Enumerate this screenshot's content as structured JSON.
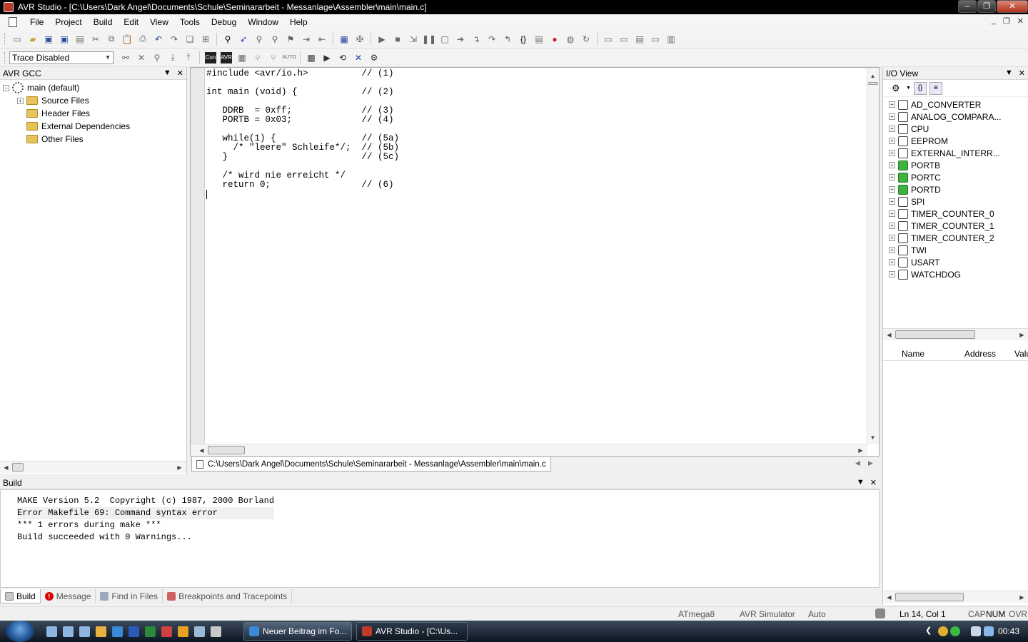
{
  "window": {
    "title": "AVR Studio - [C:\\Users\\Dark Angel\\Documents\\Schule\\Seminararbeit - Messanlage\\Assembler\\main\\main.c]"
  },
  "menu": [
    "File",
    "Project",
    "Build",
    "Edit",
    "View",
    "Tools",
    "Debug",
    "Window",
    "Help"
  ],
  "toolbar2": {
    "trace_mode": "Trace Disabled"
  },
  "project_panel": {
    "title": "AVR GCC",
    "root": "main (default)",
    "folders": [
      "Source Files",
      "Header Files",
      "External Dependencies",
      "Other Files"
    ]
  },
  "editor": {
    "lines": [
      "#include <avr/io.h>          // (1)",
      "",
      "int main (void) {            // (2)",
      "",
      "   DDRB  = 0xff;             // (3)",
      "   PORTB = 0x03;             // (4)",
      "",
      "   while(1) {                // (5a)",
      "     /* \"leere\" Schleife*/;  // (5b)",
      "   }                         // (5c)",
      "",
      "   /* wird nie erreicht */",
      "   return 0;                 // (6)",
      ""
    ],
    "tab_label": "C:\\Users\\Dark Angel\\Documents\\Schule\\Seminararbeit - Messanlage\\Assembler\\main\\main.c"
  },
  "io_view": {
    "title": "I/O View",
    "items": [
      "AD_CONVERTER",
      "ANALOG_COMPARA...",
      "CPU",
      "EEPROM",
      "EXTERNAL_INTERR...",
      "PORTB",
      "PORTC",
      "PORTD",
      "SPI",
      "TIMER_COUNTER_0",
      "TIMER_COUNTER_1",
      "TIMER_COUNTER_2",
      "TWI",
      "USART",
      "WATCHDOG"
    ],
    "columns": [
      "Name",
      "Address",
      "Valu"
    ]
  },
  "build": {
    "title": "Build",
    "lines": [
      "MAKE Version 5.2  Copyright (c) 1987, 2000 Borland",
      "Error Makefile 69: Command syntax error",
      "*** 1 errors during make ***",
      "Build succeeded with 0 Warnings..."
    ],
    "tabs": [
      "Build",
      "Message",
      "Find in Files",
      "Breakpoints and Tracepoints"
    ]
  },
  "status": {
    "device": "ATmega8",
    "platform": "AVR Simulator",
    "mode": "Auto",
    "position": "Ln 14, Col 1",
    "cap": "CAP",
    "num": "NUM",
    "ovr": "OVR"
  },
  "taskbar": {
    "tasks": [
      "Neuer Beitrag im Fo...",
      "AVR Studio - [C:\\Us..."
    ],
    "clock": "00:43"
  }
}
